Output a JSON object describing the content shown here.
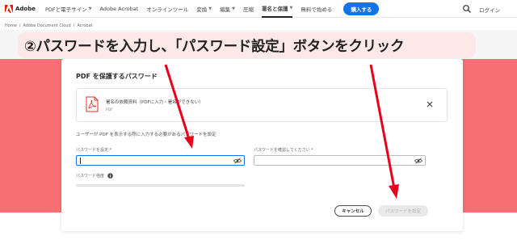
{
  "topnav": {
    "logo_text": "Adobe",
    "items": [
      {
        "label": "PDFと電子サイン",
        "dropdown": true,
        "active": false
      },
      {
        "label": "Adobe Acrobat",
        "dropdown": false,
        "active": false
      },
      {
        "label": "オンラインツール",
        "dropdown": false,
        "active": false
      },
      {
        "label": "変換",
        "dropdown": true,
        "active": false
      },
      {
        "label": "編集",
        "dropdown": true,
        "active": false
      },
      {
        "label": "圧縮",
        "dropdown": false,
        "active": false
      },
      {
        "label": "署名と保護",
        "dropdown": true,
        "active": true
      },
      {
        "label": "無料で始める",
        "dropdown": false,
        "active": false
      }
    ],
    "buy_label": "購入する",
    "login_label": "ログイン"
  },
  "breadcrumb": [
    "Home",
    "/",
    "Adobe Document Cloud",
    "/",
    "Acrobat"
  ],
  "instruction": "②パスワードを入力し、「パスワード設定」ボタンをクリック",
  "dialog": {
    "title": "PDF を保護するパスワード",
    "file_name": "署名の依頼資料（PDFに入力・署名ができない）",
    "file_type": "PDF",
    "description": "ユーザーが PDF を表示する際に入力する必要があるパスワードを設定",
    "password_label": "パスワードを設定 *",
    "password_value": "",
    "confirm_label": "パスワードを確認してください *",
    "confirm_value": "",
    "strength_label": "パスワード強度",
    "strength_value": 0,
    "cancel_label": "キャンセル",
    "set_label": "パスワードを設定"
  },
  "colors": {
    "accent": "#1473e6",
    "band": "#f86f74",
    "arrow": "#e8001c",
    "banner": "#fde8e8",
    "adobe_red": "#fa0f00"
  }
}
